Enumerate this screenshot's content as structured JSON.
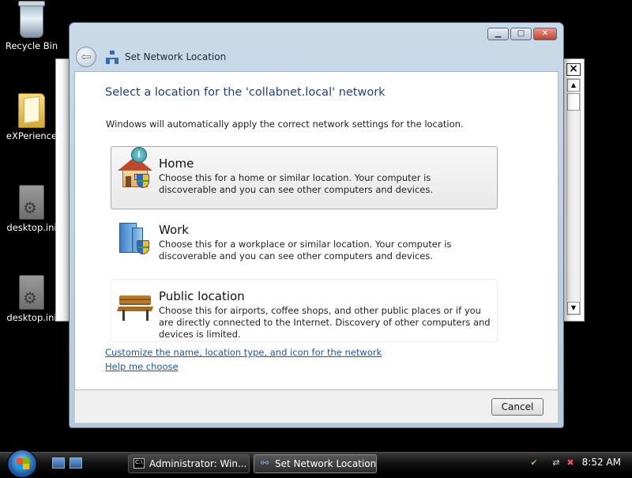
{
  "desktop": {
    "icons": [
      {
        "label": "Recycle Bin",
        "icon": "recycle-bin-icon"
      },
      {
        "label": "eXPerience",
        "icon": "folder-icon"
      },
      {
        "label": "desktop.ini",
        "icon": "settings-file-icon"
      },
      {
        "label": "desktop.ini",
        "icon": "settings-file-icon"
      }
    ]
  },
  "console": {
    "close_label": "×"
  },
  "dialog": {
    "title": "Set Network Location",
    "caption": {
      "minimize": "▁",
      "maximize": "□",
      "close": "✕"
    },
    "heading": "Select a location for the 'collabnet.local' network",
    "intro": "Windows will automatically apply the correct network settings for the location.",
    "options": [
      {
        "title": "Home",
        "description": "Choose this for a home or similar location. Your computer is discoverable and you can see other computers and devices.",
        "selected": true
      },
      {
        "title": "Work",
        "description": "Choose this for a workplace or similar location. Your computer is discoverable and you can see other computers and devices.",
        "selected": false
      },
      {
        "title": "Public location",
        "description": "Choose this for airports, coffee shops, and other public places or if you are directly connected to the Internet. Discovery of other computers and devices is limited.",
        "selected": false
      }
    ],
    "links": {
      "customize": "Customize the name, location type, and icon for the network",
      "help": "Help me choose"
    },
    "cancel_label": "Cancel",
    "cursor_glyph": "i"
  },
  "taskbar": {
    "buttons": [
      {
        "label": "Administrator:  Win..."
      },
      {
        "label": "Set Network Location"
      }
    ],
    "clock": "8:52 AM"
  }
}
